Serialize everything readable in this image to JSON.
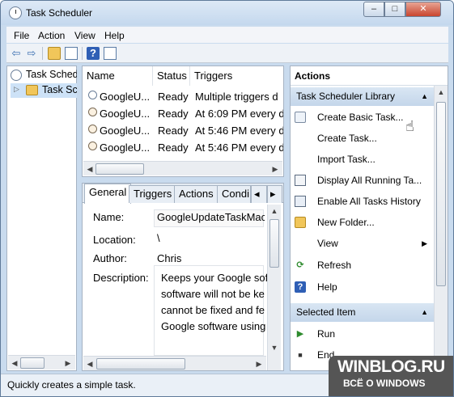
{
  "window": {
    "title": "Task Scheduler"
  },
  "controls": {
    "minimize": "–",
    "maximize": "□",
    "close": "✕"
  },
  "menubar": [
    "File",
    "Action",
    "View",
    "Help"
  ],
  "toolbar": {
    "back": "⇦",
    "forward": "⇨",
    "up_folder": "folder-up-icon",
    "show_hide_tree": "tree-icon",
    "help": "?",
    "show_hide_action": "action-pane-icon"
  },
  "tree": {
    "root": "Task Scheduler (Local)",
    "root_visible": "Task Sched",
    "child_visible": "Task Schec",
    "expander": "▷"
  },
  "tasks": {
    "columns": [
      "Name",
      "Status",
      "Triggers"
    ],
    "rows": [
      {
        "name": "GoogleU...",
        "status": "Ready",
        "triggers": "Multiple triggers d"
      },
      {
        "name": "GoogleU...",
        "status": "Ready",
        "triggers": "At 6:09 PM every d"
      },
      {
        "name": "GoogleU...",
        "status": "Ready",
        "triggers": "At 5:46 PM every d"
      },
      {
        "name": "GoogleU...",
        "status": "Ready",
        "triggers": "At 5:46 PM every d"
      }
    ]
  },
  "detail": {
    "tabs": [
      "General",
      "Triggers",
      "Actions",
      "Condi"
    ],
    "tab_nav": {
      "prev": "◂",
      "next": "▸"
    },
    "labels": {
      "name": "Name:",
      "location": "Location:",
      "author": "Author:",
      "description": "Description:"
    },
    "values": {
      "name": "GoogleUpdateTaskMac",
      "location": "\\",
      "author": "Chris",
      "description_lines": [
        "Keeps your Google sof",
        "software will not be ke",
        "cannot be fixed and fe",
        "Google software using"
      ]
    }
  },
  "actions": {
    "header": "Actions",
    "sections": [
      {
        "title": "Task Scheduler Library",
        "chevron": "▲",
        "items": [
          {
            "label": "Create Basic Task...",
            "icon": "wizard-icon"
          },
          {
            "label": "Create Task...",
            "icon": ""
          },
          {
            "label": "Import Task...",
            "icon": ""
          },
          {
            "label": "Display All Running Ta...",
            "icon": "running-tasks-icon"
          },
          {
            "label": "Enable All Tasks History",
            "icon": "history-icon"
          },
          {
            "label": "New Folder...",
            "icon": "folder-icon"
          },
          {
            "label": "View",
            "icon": "",
            "submenu": "▶"
          },
          {
            "label": "Refresh",
            "icon": "refresh-icon"
          },
          {
            "label": "Help",
            "icon": "help-icon"
          }
        ]
      },
      {
        "title": "Selected Item",
        "chevron": "▲",
        "items": [
          {
            "label": "Run",
            "icon": "run-icon"
          },
          {
            "label": "End",
            "icon": "end-icon"
          }
        ]
      }
    ]
  },
  "status": "Quickly creates a simple task.",
  "watermark": {
    "site": "WINBLOG.RU",
    "tagline": "ВСЁ О WINDOWS"
  },
  "colors": {
    "selection": "#cde2f7",
    "section_header": "#c9dbee",
    "watermark_bg": "#555555"
  }
}
